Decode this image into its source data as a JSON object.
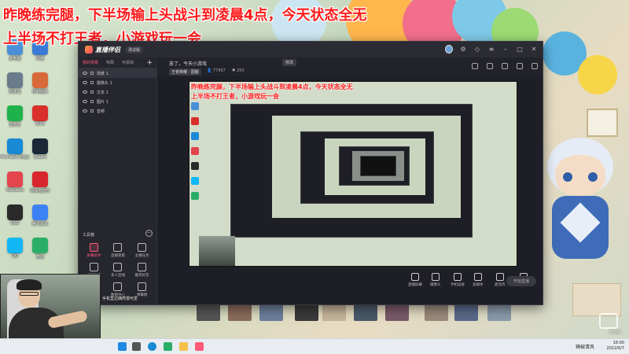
{
  "overlay_banner": {
    "line1": "昨晚练完腿，下半场输上头战斗到凌晨4点，今天状态全无",
    "line2": "上半场不打王者，小游戏玩一会"
  },
  "desktop": {
    "icons": [
      {
        "label": "此电脑",
        "color": "#4a90d9"
      },
      {
        "label": "网络",
        "color": "#3a7bd5"
      },
      {
        "label": "回收站",
        "color": "#6a7b8c"
      },
      {
        "label": "控制面板",
        "color": "#d86a3a"
      },
      {
        "label": "爱奇艺",
        "color": "#1fb24a"
      },
      {
        "label": "WPS",
        "color": "#d9302c"
      },
      {
        "label": "Microsoft Edge",
        "color": "#1a8ad6"
      },
      {
        "label": "Steam",
        "color": "#1b2838"
      },
      {
        "label": "WeGame",
        "color": "#e4444c"
      },
      {
        "label": "网易云音乐",
        "color": "#d8262c"
      },
      {
        "label": "OBS",
        "color": "#2a2a2a"
      },
      {
        "label": "腾讯会议",
        "color": "#3b82f6"
      },
      {
        "label": "QQ",
        "color": "#12b7f5"
      },
      {
        "label": "微信",
        "color": "#2aae67"
      }
    ]
  },
  "app": {
    "name": "直播伴侣",
    "version": "测试版",
    "scene_tabs": [
      "我的场景",
      "布局",
      "可添加"
    ],
    "layers": [
      {
        "label": "场景 1"
      },
      {
        "label": "摄像头 1"
      },
      {
        "label": "文本 1"
      },
      {
        "label": "图片 1"
      },
      {
        "label": "音频"
      }
    ],
    "toolbox_title": "工具箱",
    "tools": [
      {
        "label": "屏幕助手",
        "hot": true
      },
      {
        "label": "直播管家",
        "hot": false
      },
      {
        "label": "主播任务",
        "hot": false
      },
      {
        "label": "视频直播",
        "hot": false
      },
      {
        "label": "多人连线",
        "hot": false
      },
      {
        "label": "推荐好友",
        "hot": false
      },
      {
        "label": "连线PK",
        "hot": false
      },
      {
        "label": "数据中心",
        "hot": false
      },
      {
        "label": "弹幕姬",
        "hot": false
      }
    ],
    "room": {
      "title": "放了，今天小游戏",
      "edit_label": "修改",
      "category": "王者荣耀 · 国服",
      "heat": "77567",
      "fans": "250"
    },
    "bottom_tools": [
      "直播屏幕",
      "摄像头",
      "手机投屏",
      "多媒体",
      "麦克风",
      "声音混音"
    ],
    "start_live_label": "开始直播"
  },
  "webcam": {
    "caption": "手机里边偶然很可爱"
  },
  "taskbar": {
    "tray_text": "辣椒清风",
    "time": "16:00",
    "date": "2022/6/7"
  },
  "watermark": {
    "text": "77697"
  }
}
